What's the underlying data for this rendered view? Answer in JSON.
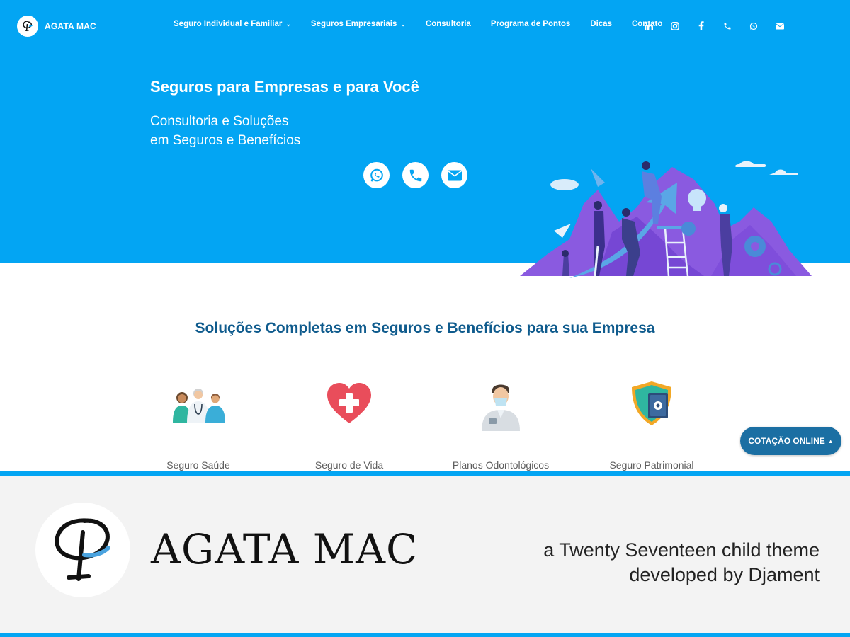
{
  "brand": {
    "name": "AGATA MAC"
  },
  "nav": {
    "items": [
      {
        "label": "Seguro Individual e Familiar",
        "has_dropdown": true
      },
      {
        "label": "Seguros Empresariais",
        "has_dropdown": true
      },
      {
        "label": "Consultoria",
        "has_dropdown": false
      },
      {
        "label": "Programa de Pontos",
        "has_dropdown": false
      },
      {
        "label": "Dicas",
        "has_dropdown": false
      },
      {
        "label": "Contato",
        "has_dropdown": false
      }
    ],
    "social_icons": [
      "linkedin-icon",
      "instagram-icon",
      "facebook-icon",
      "phone-icon",
      "whatsapp-icon",
      "email-icon"
    ]
  },
  "hero": {
    "title": "Seguros para Empresas e para Você",
    "subtitle_line1": "Consultoria e Soluções",
    "subtitle_line2": "em Seguros e Benefícios",
    "actions": [
      "whatsapp-icon",
      "phone-icon",
      "email-icon"
    ]
  },
  "solutions": {
    "title": "Soluções Completas em Seguros e Benefícios para sua Empresa",
    "cards": [
      {
        "label": "Seguro Saúde",
        "icon": "doctors-icon"
      },
      {
        "label": "Seguro de Vida",
        "icon": "heart-plus-icon"
      },
      {
        "label": "Planos Odontológicos",
        "icon": "dentist-icon"
      },
      {
        "label": "Seguro Patrimonial",
        "icon": "shield-safe-icon"
      }
    ]
  },
  "quote_button": {
    "label": "COTAÇÃO ONLINE",
    "icon": "caret-up-icon"
  },
  "banner": {
    "name": "AGATA MAC",
    "line1": "a Twenty Seventeen child theme",
    "line2": "developed by Djament"
  },
  "colors": {
    "hero_bg": "#03a5f3",
    "heading_blue": "#0f5b8d",
    "button_blue": "#1b6fa3",
    "banner_bg": "#f3f3f3"
  }
}
